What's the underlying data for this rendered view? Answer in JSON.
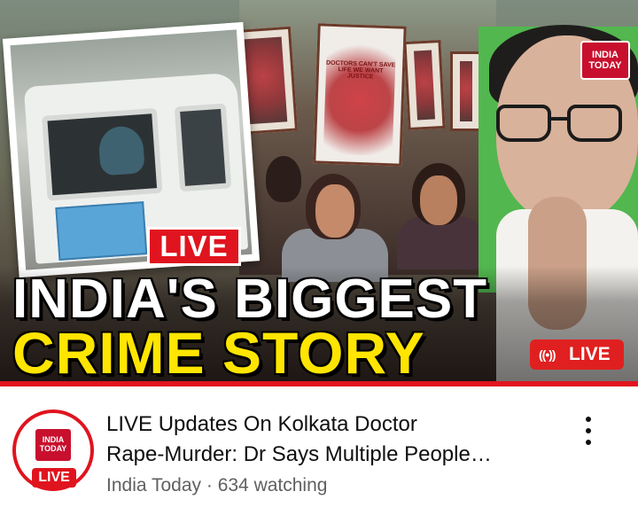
{
  "thumbnail": {
    "live_tag": "LIVE",
    "headline_line1": "INDIA'S BIGGEST",
    "headline_line2": "CRIME STORY",
    "live_pill_label": "LIVE",
    "live_pill_icon": "radio-broadcast-icon",
    "corner_logo": "INDIA TODAY",
    "poster_text": "DOCTORS CAN'T SAVE LIFE WE WANT JUSTICE",
    "colors": {
      "live_red": "#e0141e",
      "headline_yellow": "#ffe500",
      "brand_red": "#c8102e"
    }
  },
  "channel": {
    "logo_text": "INDIA TODAY",
    "live_badge": "LIVE"
  },
  "video": {
    "title_line1": "LIVE Updates On Kolkata Doctor",
    "title_line2": "Rape-Murder: Dr Says Multiple People…",
    "meta": "India Today · 634 watching"
  },
  "menu": {
    "icon": "more-vertical-icon"
  }
}
